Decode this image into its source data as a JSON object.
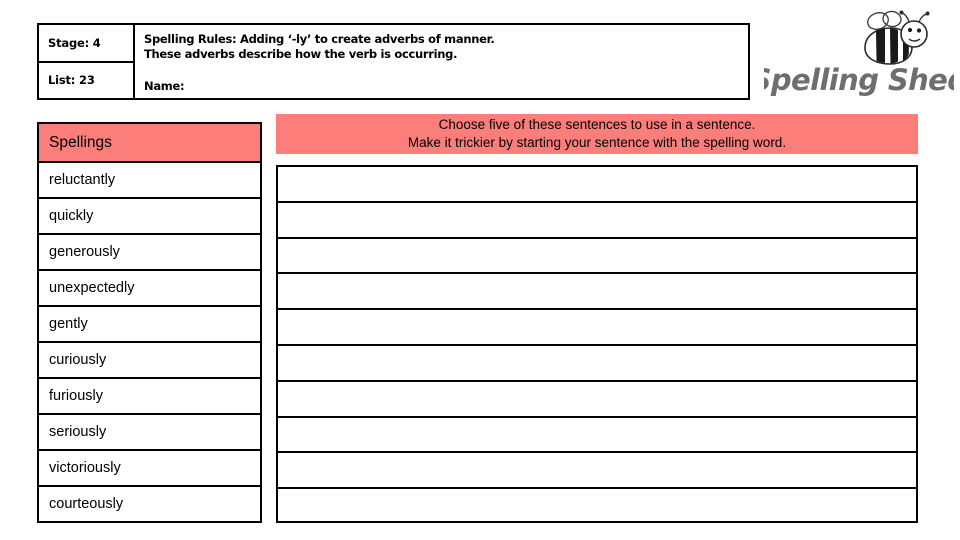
{
  "header": {
    "stage_label": "Stage: 4",
    "list_label": "List: 23",
    "rule_line1": "Spelling Rules: Adding ‘-ly’ to create adverbs of manner.",
    "rule_line2": "These adverbs describe how the verb is occurring.",
    "name_label": "Name:"
  },
  "logo": {
    "wordmark": "Spelling Shed",
    "bee_icon": "bee-icon"
  },
  "spellings": {
    "header_label": "Spellings",
    "words": [
      "reluctantly",
      "quickly",
      "generously",
      "unexpectedly",
      "gently",
      "curiously",
      "furiously",
      "seriously",
      "victoriously",
      "courteously"
    ]
  },
  "instructions": {
    "line1": "Choose five of these sentences to use in a sentence.",
    "line2": "Make it trickier by starting your sentence with the spelling word."
  },
  "answers": {
    "rows": [
      "",
      "",
      "",
      "",
      "",
      "",
      "",
      "",
      "",
      ""
    ]
  },
  "colors": {
    "accent_pink": "#fb7e7a",
    "border": "#000000",
    "page_background": "#ffffff",
    "logo_gray": "#6e6e6e"
  }
}
